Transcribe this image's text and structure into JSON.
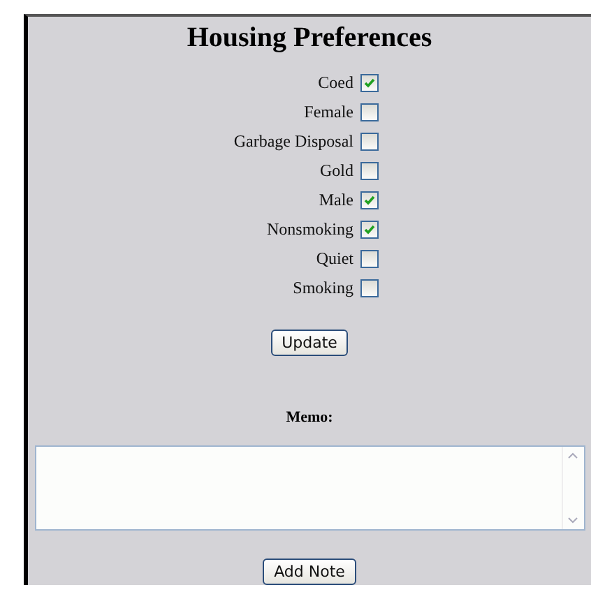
{
  "title": "Housing Preferences",
  "preferences": [
    {
      "label": "Coed",
      "checked": true
    },
    {
      "label": "Female",
      "checked": false
    },
    {
      "label": "Garbage Disposal",
      "checked": false
    },
    {
      "label": "Gold",
      "checked": false
    },
    {
      "label": "Male",
      "checked": true
    },
    {
      "label": "Nonsmoking",
      "checked": true
    },
    {
      "label": "Quiet",
      "checked": false
    },
    {
      "label": "Smoking",
      "checked": false
    }
  ],
  "update_button": "Update",
  "memo": {
    "label": "Memo:"
  },
  "add_note_button": "Add Note"
}
